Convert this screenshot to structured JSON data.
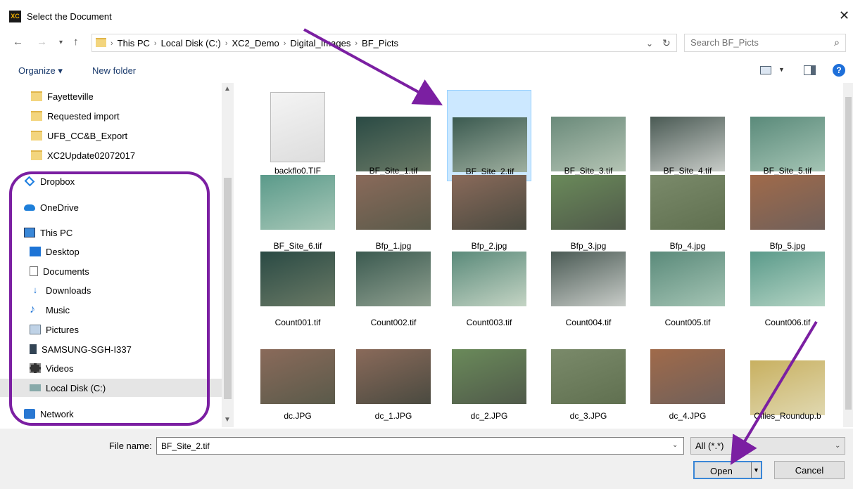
{
  "window": {
    "title": "Select the Document",
    "app_badge": "XC"
  },
  "address": {
    "crumbs": [
      "This PC",
      "Local Disk (C:)",
      "XC2_Demo",
      "Digital_Images",
      "BF_Picts"
    ],
    "separator": "›"
  },
  "search": {
    "placeholder": "Search BF_Picts"
  },
  "toolbar": {
    "organize": "Organize ▾",
    "new_folder": "New folder"
  },
  "sidebar": {
    "items": [
      {
        "label": "Fayetteville",
        "icon": "folder-icon"
      },
      {
        "label": "Requested import",
        "icon": "folder-icon"
      },
      {
        "label": "UFB_CC&B_Export",
        "icon": "folder-icon"
      },
      {
        "label": "XC2Update02072017",
        "icon": "folder-icon"
      },
      {
        "label": "Dropbox",
        "icon": "dropbox-icon"
      },
      {
        "label": "OneDrive",
        "icon": "cloud-icon"
      },
      {
        "label": "This PC",
        "icon": "computer-icon"
      },
      {
        "label": "Desktop",
        "icon": "desktop-icon"
      },
      {
        "label": "Documents",
        "icon": "document-icon"
      },
      {
        "label": "Downloads",
        "icon": "download-icon"
      },
      {
        "label": "Music",
        "icon": "music-icon"
      },
      {
        "label": "Pictures",
        "icon": "picture-icon"
      },
      {
        "label": "SAMSUNG-SGH-I337",
        "icon": "phone-icon"
      },
      {
        "label": "Videos",
        "icon": "video-icon"
      },
      {
        "label": "Local Disk (C:)",
        "icon": "disk-icon"
      },
      {
        "label": "Network",
        "icon": "network-icon"
      }
    ],
    "selected": "Local Disk (C:)"
  },
  "files": [
    "backflo0.TIF",
    "BF_Site_1.tif",
    "BF_Site_2.tif",
    "BF_Site_3.tif",
    "BF_Site_4.tif",
    "BF_Site_5.tif",
    "BF_Site_6.tif",
    "Bfp_1.jpg",
    "Bfp_2.jpg",
    "Bfp_3.jpg",
    "Bfp_4.jpg",
    "Bfp_5.jpg",
    "Count001.tif",
    "Count002.tif",
    "Count003.tif",
    "Count004.tif",
    "Count005.tif",
    "Count006.tif",
    "dc.JPG",
    "dc_1.JPG",
    "dc_2.JPG",
    "dc_3.JPG",
    "dc_4.JPG",
    "Ollies_Roundup.b"
  ],
  "selected_file": "BF_Site_2.tif",
  "footer": {
    "file_name_label": "File name:",
    "file_name_value": "BF_Site_2.tif",
    "filter": "All (*.*)",
    "open": "Open",
    "cancel": "Cancel"
  },
  "annotation_color": "#7b1fa2"
}
